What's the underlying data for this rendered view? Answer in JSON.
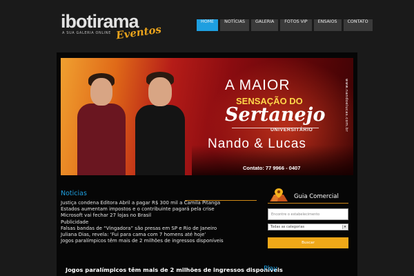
{
  "logo": {
    "main": "ibotirama",
    "script": "Eventos",
    "tagline": "A SUA GALERIA ONLINE"
  },
  "nav": {
    "items": [
      {
        "label": "HOME",
        "active": true
      },
      {
        "label": "NOTÍCIAS",
        "active": false
      },
      {
        "label": "GALERIA",
        "active": false
      },
      {
        "label": "FOTOS VIP",
        "active": false
      },
      {
        "label": "ENSAIOS",
        "active": false
      },
      {
        "label": "CONTATO",
        "active": false
      }
    ]
  },
  "banner": {
    "line1": "A MAIOR",
    "line2": "SENSAÇÃO DO",
    "line3": "Sertanejo",
    "line4": "UNIVERSITÁRIO",
    "artists": "Nando & Lucas",
    "contact": "Contato: 77 9966 - 0407",
    "side_text": "www.nandoelucas.com.br"
  },
  "news": {
    "title": "Noticias",
    "items": [
      "Justiça condena Editora Abril a pagar R$ 300 mil a Camila Pitanga",
      "Estados aumentam impostos e o contribuinte pagará pela crise",
      "Microsoft vai fechar 27 lojas no Brasil",
      "Publicidade",
      "Falsas bandas de “Vingadora” são presas em SP e Rio de Janeiro",
      "Juliana Dias, revela: ‘Fui para cama com 7 homens até hoje’",
      "Jogos paralímpicos têm mais de 2 milhões de ingressos disponíveis"
    ],
    "headline": "Jogos paralímpicos têm mais de 2 milhões de ingressos disponíveis"
  },
  "guia": {
    "title": "Guia Comercial",
    "search_placeholder": "Encontre o estabelecimento",
    "category_selected": "Todas as categorias",
    "button_label": "Buscar"
  },
  "play": {
    "title": "Play"
  },
  "colors": {
    "accent_blue": "#1e9fe0",
    "accent_orange": "#f0a818",
    "background": "#1a1a1a"
  }
}
